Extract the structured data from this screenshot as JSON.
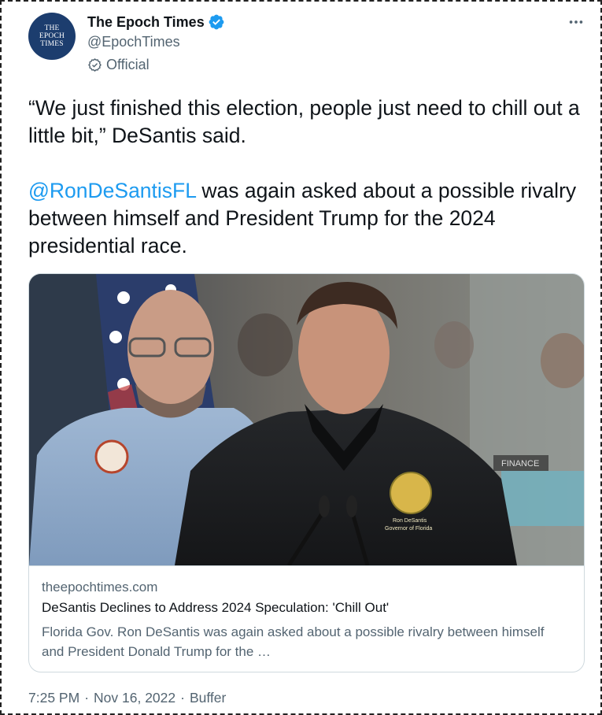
{
  "account": {
    "avatar_lines": [
      "THE",
      "EPOCH",
      "TIMES"
    ],
    "display_name": "The Epoch Times",
    "handle": "@EpochTimes",
    "label": "Official"
  },
  "tweet": {
    "paragraph1": "“We just finished this election, people just need to chill out a little bit,” DeSantis said.",
    "mention": "@RonDeSantisFL",
    "paragraph2_rest": " was again asked about a possible rivalry between himself and President Trump for the 2024 presidential race."
  },
  "card": {
    "domain": "theepochtimes.com",
    "title": "DeSantis Declines to Address 2024 Speculation: 'Chill Out'",
    "description": "Florida Gov. Ron DeSantis was again asked about a possible rivalry between himself and President Donald Trump for the …",
    "image_seal_text_1": "Ron DeSantis",
    "image_seal_text_2": "Governor of Florida",
    "image_sign_text": "FINANCE"
  },
  "meta": {
    "time": "7:25 PM",
    "date": "Nov 16, 2022",
    "source": "Buffer",
    "separator": "·"
  },
  "colors": {
    "link": "#1d9bf0",
    "verified": "#1d9bf0",
    "secondary_text": "#536471",
    "avatar_bg": "#1c3d6e"
  },
  "icons": {
    "verified": "verified-badge-icon",
    "official": "official-label-icon",
    "more": "more-horizontal-icon"
  }
}
